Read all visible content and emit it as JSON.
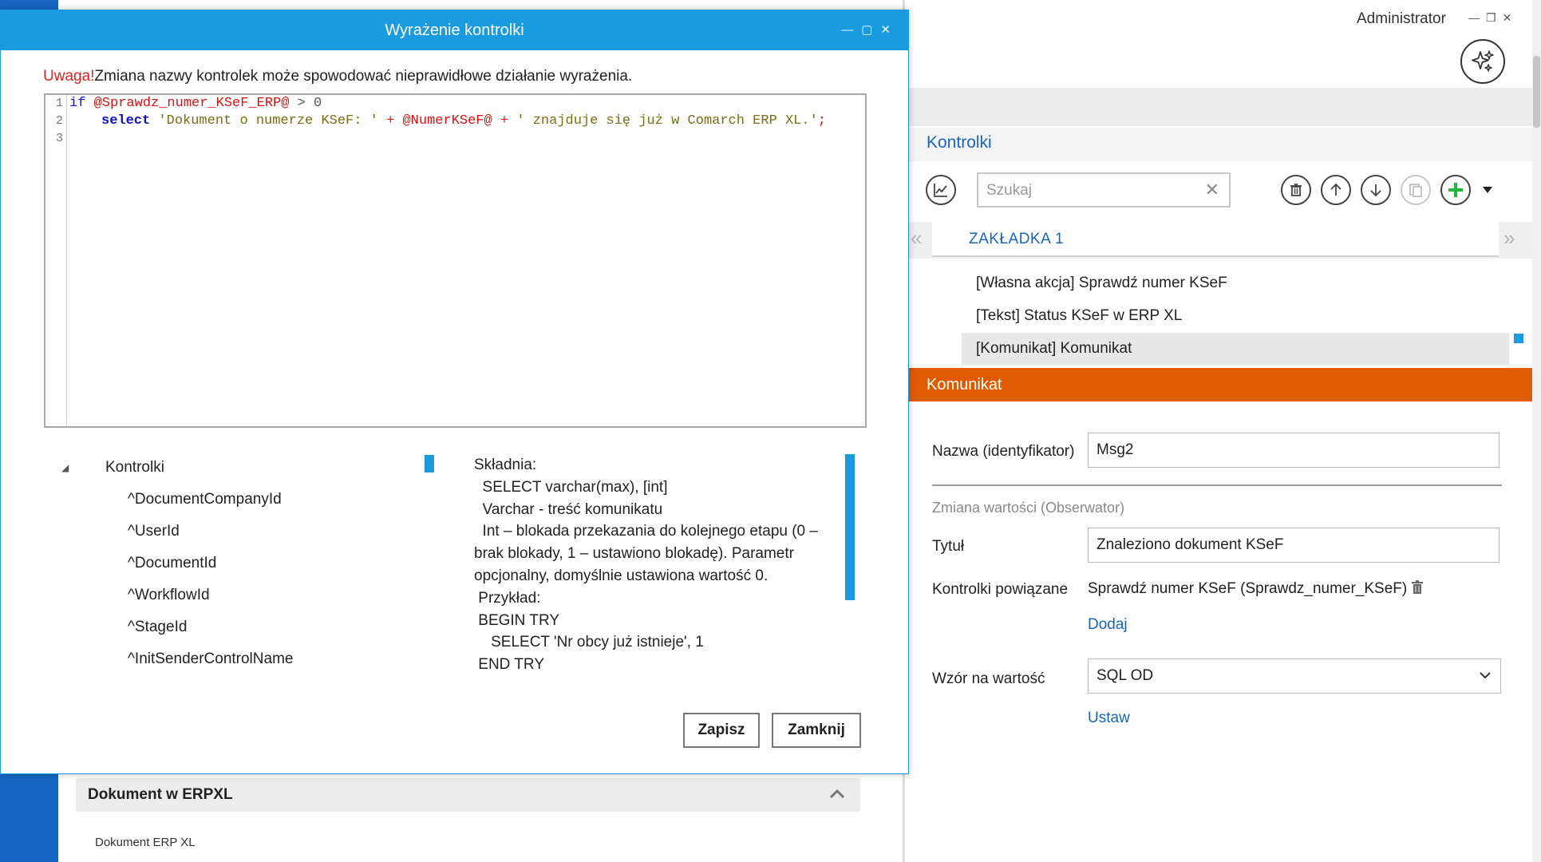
{
  "dialog": {
    "title": "Wyrażenie kontrolki",
    "window_controls": "_ ▢ ✕",
    "warning_prefix": "Uwaga!",
    "warning_text": "Zmiana nazwy kontrolek może spowodować nieprawidłowe działanie wyrażenia.",
    "editor": {
      "line_numbers": [
        "1",
        "2",
        "3"
      ],
      "line1": {
        "kw": "if",
        "var": "@Sprawdz_numer_KSeF_ERP@",
        "rest": " > 0"
      },
      "line2": {
        "kw": "select",
        "str1": "'Dokument o numerze KSeF: '",
        "op1": " + ",
        "var": "@NumerKSeF@",
        "op2": " + ",
        "str2": "' znajduje się już w Comarch ERP XL.'",
        "end": ";"
      }
    },
    "tree": {
      "root": "Kontrolki",
      "children": [
        "^DocumentCompanyId",
        "^UserId",
        "^DocumentId",
        "^WorkflowId",
        "^StageId",
        "^InitSenderControlName"
      ]
    },
    "help_lines": [
      "Składnia:",
      "  SELECT varchar(max), [int]",
      "  Varchar - treść komunikatu",
      "  Int – blokada przekazania do kolejnego etapu (0 –",
      "brak blokady, 1 – ustawiono blokadę). Parametr",
      "opcjonalny, domyślnie ustawiona wartość 0.",
      " Przykład:",
      " BEGIN TRY",
      "    SELECT 'Nr obcy już istnieje', 1",
      " END TRY"
    ],
    "save_label": "Zapisz",
    "close_label": "Zamknij"
  },
  "background": {
    "section_title": "Dokument w ERPXL",
    "section_sub": "Dokument ERP XL"
  },
  "right": {
    "user": "Administrator",
    "kontrolki_title": "Kontrolki",
    "search_placeholder": "Szukaj",
    "tab_label": "ZAKŁADKA 1",
    "list_items": [
      "[Własna akcja] Sprawdź numer KSeF",
      "[Tekst] Status KSeF w ERP XL",
      "[Komunikat] Komunikat"
    ],
    "section_header": "Komunikat",
    "nazwa_label": "Nazwa (identyfikator)",
    "nazwa_value": "Msg2",
    "zmiana_label": "Zmiana wartości (Obserwator)",
    "tytul_label": "Tytuł",
    "tytul_value": "Znaleziono dokument KSeF",
    "kontrolki_powiazane_label": "Kontrolki powiązane",
    "kontrolki_powiazane_value": "Sprawdź numer KSeF (Sprawdz_numer_KSeF)",
    "dodaj_label": "Dodaj",
    "wzor_label": "Wzór na wartość",
    "wzor_value": "SQL OD",
    "ustaw_label": "Ustaw"
  },
  "colors": {
    "accent_blue": "#1a9be0",
    "link_blue": "#1565c0",
    "header_orange": "#e05a00",
    "warning_red": "#e32020",
    "add_green": "#1fb83a"
  }
}
